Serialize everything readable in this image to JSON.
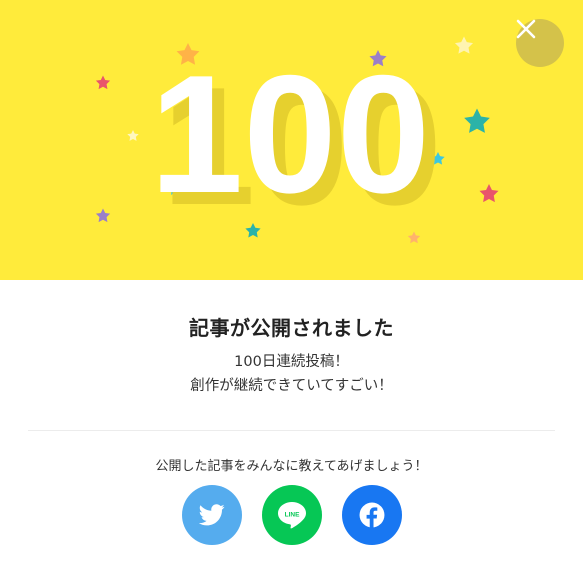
{
  "hero": {
    "number": "100",
    "colors": {
      "background": "#ffeb3b",
      "number": "#ffffff",
      "shadow": "#e6d02e"
    }
  },
  "close_button": {
    "icon": "close-icon"
  },
  "dialog": {
    "title": "記事が公開されました",
    "message_line1": "100日連続投稿！",
    "message_line2": "創作が継続できていてすごい！"
  },
  "share": {
    "prompt": "公開した記事をみんなに教えてあげましょう！",
    "buttons": [
      {
        "name": "twitter",
        "icon": "twitter-bird-icon",
        "color": "#55acee"
      },
      {
        "name": "line",
        "icon": "line-icon",
        "label": "LINE",
        "color": "#06c755"
      },
      {
        "name": "facebook",
        "icon": "facebook-f-icon",
        "color": "#1877f2"
      }
    ]
  }
}
